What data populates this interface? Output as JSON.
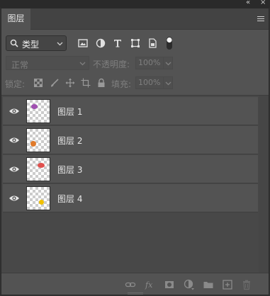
{
  "window": {
    "collapse_glyph": "«",
    "close_glyph": "×"
  },
  "tabs": [
    {
      "label": "图层",
      "active": true
    }
  ],
  "filter": {
    "kind_label": "类型",
    "icons": [
      "image-filter-icon",
      "adjustment-filter-icon",
      "type-filter-icon",
      "shape-filter-icon",
      "smart-object-filter-icon",
      "filter-toggle-icon"
    ]
  },
  "blend": {
    "mode": "正常",
    "opacity_label": "不透明度:",
    "opacity_value": "100%"
  },
  "lock": {
    "label": "锁定:",
    "fill_label": "填充:",
    "fill_value": "100%"
  },
  "layers": [
    {
      "name": "图层 1",
      "visible": true,
      "sprite_color": "#a04fb0"
    },
    {
      "name": "图层 2",
      "visible": true,
      "sprite_color": "#e07a2a"
    },
    {
      "name": "图层 3",
      "visible": true,
      "sprite_color": "#e0504e"
    },
    {
      "name": "图层 4",
      "visible": true,
      "sprite_color": "#f0c000"
    }
  ],
  "colors": {
    "panel_bg": "#535353",
    "list_bg": "#484848",
    "text": "#e6e6e6",
    "muted_text": "#7f7f7f"
  }
}
